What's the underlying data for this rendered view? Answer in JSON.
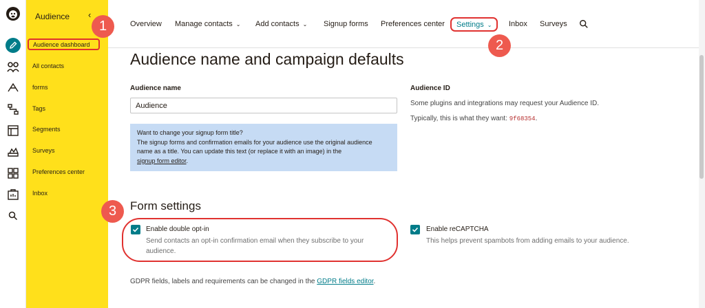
{
  "sidebar": {
    "title": "Audience",
    "collapse_icon": "chevron-left-icon",
    "items": [
      {
        "label": "Audience dashboard",
        "active": true
      },
      {
        "label": "All contacts"
      },
      {
        "label": "forms"
      },
      {
        "label": "Tags"
      },
      {
        "label": "Segments"
      },
      {
        "label": "Surveys"
      },
      {
        "label": "Preferences center"
      },
      {
        "label": "Inbox"
      }
    ]
  },
  "rail": {
    "icons": [
      "mailchimp-logo-icon",
      "create-pencil-icon",
      "audience-icon",
      "campaigns-icon",
      "automations-icon",
      "website-icon",
      "content-studio-icon",
      "integrations-icon",
      "analytics-icon",
      "search-icon"
    ]
  },
  "topnav": {
    "tabs": [
      {
        "label": "Overview"
      },
      {
        "label": "Manage contacts",
        "dropdown": true
      },
      {
        "label": "Add contacts",
        "dropdown": true
      },
      {
        "label": "Signup forms"
      },
      {
        "label": "Preferences center"
      },
      {
        "label": "Settings",
        "dropdown": true,
        "active": true
      },
      {
        "label": "Inbox"
      },
      {
        "label": "Surveys"
      }
    ],
    "search_icon": "search-icon"
  },
  "main": {
    "title": "Audience name and campaign defaults",
    "audience_name_label": "Audience name",
    "audience_name_value": "Audience",
    "audience_id_label": "Audience ID",
    "audience_id_text1": "Some plugins and integrations may request your Audience ID.",
    "audience_id_text2_prefix": "Typically, this is what they want: ",
    "audience_id_value": "9f68354",
    "audience_id_text2_suffix": ".",
    "infobox": {
      "title": "Want to change your signup form title?",
      "line1": "The signup forms and confirmation emails for your audience use the original audience",
      "line2": "name as a title. You can update this text (or replace it with an image) in the",
      "link": "signup form editor",
      "link_suffix": "."
    },
    "form_settings_title": "Form settings",
    "double_optin": {
      "label": "Enable double opt-in",
      "checked": true,
      "desc_line1": "Send contacts an opt-in confirmation email when they subscribe to your",
      "desc_line2": "audience."
    },
    "recaptcha": {
      "label": "Enable reCAPTCHA",
      "checked": true,
      "desc": "This helps prevent spambots from adding emails to your audience."
    },
    "gdpr_prefix": "GDPR fields, labels and requirements can be changed in the ",
    "gdpr_link": "GDPR fields editor",
    "gdpr_suffix": "."
  },
  "callouts": [
    "1",
    "2",
    "3"
  ],
  "colors": {
    "sidebar_bg": "#ffe01b",
    "accent": "#007c89",
    "highlight_red": "#e0312f",
    "badge_red": "#ee5a4f",
    "infobox_bg": "#c6dbf4"
  }
}
